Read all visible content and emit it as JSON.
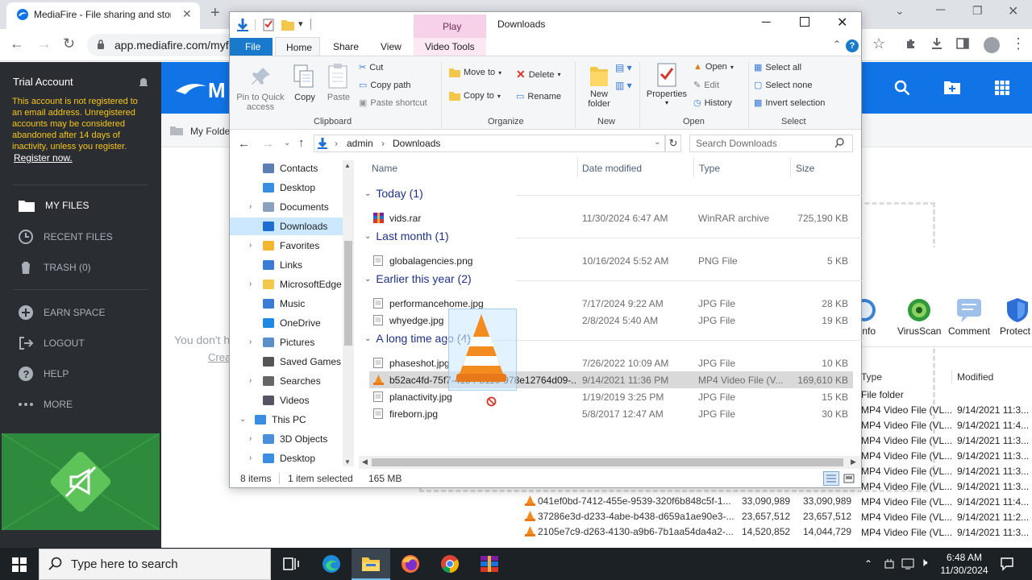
{
  "browser": {
    "tab_title": "MediaFire - File sharing and storage",
    "url": "app.mediafire.com/myfiles"
  },
  "mediafire": {
    "trial_title": "Trial Account",
    "trial_msg": "This account is not registered to an email address. Unregistered accounts may be considered abandoned after 14 days of inactivity, unless you register.",
    "register_link": "Register now.",
    "nav": [
      {
        "label": "MY FILES",
        "icon": "folder-icon"
      },
      {
        "label": "RECENT FILES",
        "icon": "clock-icon"
      },
      {
        "label": "TRASH (0)",
        "icon": "trash-icon"
      },
      {
        "label": "EARN SPACE",
        "icon": "plus-circle-icon"
      },
      {
        "label": "LOGOUT",
        "icon": "logout-icon"
      },
      {
        "label": "HELP",
        "icon": "help-icon"
      },
      {
        "label": "MORE",
        "icon": "more-icon"
      }
    ],
    "breadcrumb": "My Folders",
    "empty_text": "You don't h",
    "empty_link": "Crea",
    "tools": [
      {
        "label": "Info",
        "icon": "info-icon"
      },
      {
        "label": "VirusScan",
        "icon": "virus-icon"
      },
      {
        "label": "Comment",
        "icon": "comment-icon"
      },
      {
        "label": "Protect",
        "icon": "shield-icon"
      }
    ],
    "table_cols": {
      "type": "Type",
      "modified": "Modified"
    },
    "table_rows": [
      {
        "type": "File folder",
        "modified": ""
      },
      {
        "type": "MP4 Video File (VL...",
        "modified": "9/14/2021 11:3..."
      },
      {
        "type": "MP4 Video File (VL...",
        "modified": "9/14/2021 11:4..."
      },
      {
        "type": "MP4 Video File (VL...",
        "modified": "9/14/2021 11:3..."
      },
      {
        "type": "MP4 Video File (VL...",
        "modified": "9/14/2021 11:3..."
      },
      {
        "type": "MP4 Video File (VL...",
        "modified": "9/14/2021 11:3..."
      },
      {
        "type": "MP4 Video File (VL...",
        "modified": "9/14/2021 11:3..."
      },
      {
        "type": "MP4 Video File (VL...",
        "modified": "9/14/2021 11:4..."
      },
      {
        "type": "MP4 Video File (VL...",
        "modified": "9/14/2021 11:2..."
      },
      {
        "type": "MP4 Video File (VL...",
        "modified": "9/14/2021 11:3..."
      }
    ],
    "back_rows": [
      {
        "name": "041ef0bd-7412-455e-9539-320f6b848c5f-1...",
        "a": "33,090,989",
        "b": "33,090,989"
      },
      {
        "name": "37286e3d-d233-4abe-b438-d659a1ae90e3-...",
        "a": "23,657,512",
        "b": "23,657,512"
      },
      {
        "name": "2105e7c9-d263-4130-a9b6-7b1aa54da4a2-...",
        "a": "14,520,852",
        "b": "14,044,729"
      }
    ]
  },
  "explorer": {
    "title": "Downloads",
    "play_tab": "Play",
    "tabs": {
      "file": "File",
      "home": "Home",
      "share": "Share",
      "view": "View",
      "video": "Video Tools"
    },
    "ribbon": {
      "pin": "Pin to Quick access",
      "copy": "Copy",
      "paste": "Paste",
      "cut": "Cut",
      "copy_path": "Copy path",
      "paste_shortcut": "Paste shortcut",
      "move_to": "Move to",
      "copy_to": "Copy to",
      "delete": "Delete",
      "rename": "Rename",
      "new_folder": "New folder",
      "properties": "Properties",
      "open": "Open",
      "edit": "Edit",
      "history": "History",
      "select_all": "Select all",
      "select_none": "Select none",
      "invert": "Invert selection",
      "grp_clipboard": "Clipboard",
      "grp_organize": "Organize",
      "grp_new": "New",
      "grp_open": "Open",
      "grp_select": "Select"
    },
    "path": [
      "admin",
      "Downloads"
    ],
    "search_placeholder": "Search Downloads",
    "nav": [
      "Contacts",
      "Desktop",
      "Documents",
      "Downloads",
      "Favorites",
      "Links",
      "MicrosoftEdge",
      "Music",
      "OneDrive",
      "Pictures",
      "Saved Games",
      "Searches",
      "Videos",
      "This PC",
      "3D Objects",
      "Desktop"
    ],
    "columns": {
      "name": "Name",
      "date": "Date modified",
      "type": "Type",
      "size": "Size"
    },
    "groups": [
      {
        "label": "Today (1)",
        "files": [
          {
            "name": "vids.rar",
            "date": "11/30/2024 6:47 AM",
            "type": "WinRAR archive",
            "size": "725,190 KB",
            "icon": "rar-icon"
          }
        ]
      },
      {
        "label": "Last month (1)",
        "files": [
          {
            "name": "globalagencies.png",
            "date": "10/16/2024 5:52 AM",
            "type": "PNG File",
            "size": "5 KB",
            "icon": "image-file-icon"
          }
        ]
      },
      {
        "label": "Earlier this year (2)",
        "files": [
          {
            "name": "performancehome.jpg",
            "date": "7/17/2024 9:22 AM",
            "type": "JPG File",
            "size": "28 KB",
            "icon": "image-file-icon"
          },
          {
            "name": "whyedge.jpg",
            "date": "2/8/2024 5:40 AM",
            "type": "JPG File",
            "size": "19 KB",
            "icon": "image-file-icon"
          }
        ]
      },
      {
        "label": "A long time ago (4)",
        "files": [
          {
            "name": "phaseshot.jpg",
            "date": "7/26/2022 10:09 AM",
            "type": "JPG File",
            "size": "10 KB",
            "icon": "image-file-icon"
          },
          {
            "name": "b52ac4fd-75f7-4154-b116-978e12764d09-...",
            "date": "9/14/2021 11:36 PM",
            "type": "MP4 Video File (V...",
            "size": "169,610 KB",
            "icon": "vlc-icon",
            "selected": true
          },
          {
            "name": "planactivity.jpg",
            "date": "1/19/2019 3:25 PM",
            "type": "JPG File",
            "size": "15 KB",
            "icon": "image-file-icon"
          },
          {
            "name": "fireborn.jpg",
            "date": "5/8/2017 12:47 AM",
            "type": "JPG File",
            "size": "30 KB",
            "icon": "image-file-icon"
          }
        ]
      }
    ],
    "status_items": "8 items",
    "status_selected": "1 item selected",
    "status_size": "165 MB"
  },
  "taskbar": {
    "search_placeholder": "Type here to search",
    "time": "6:48 AM",
    "date": "11/30/2024"
  },
  "colors": {
    "mf_blue": "#1074e6",
    "mf_sidebar": "#2a2e33",
    "trial_text": "#f5c518",
    "selection": "#cce8ff"
  }
}
